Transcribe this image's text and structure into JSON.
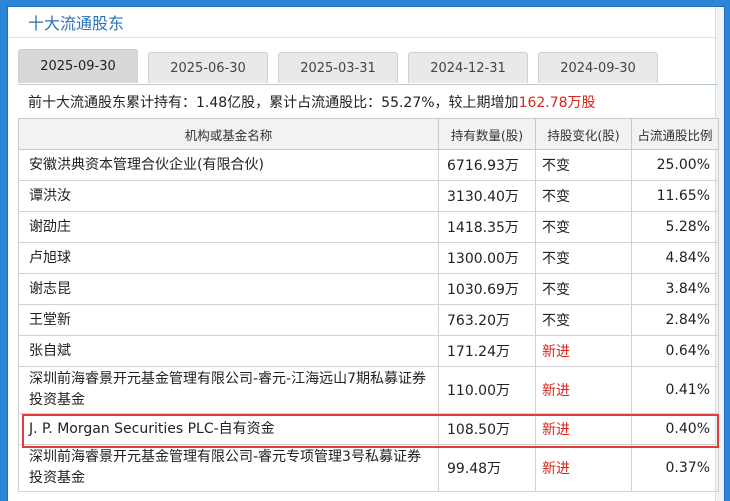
{
  "header": {
    "title": "十大流通股东"
  },
  "tabs": [
    {
      "label": "2025-09-30"
    },
    {
      "label": "2025-06-30"
    },
    {
      "label": "2025-03-31"
    },
    {
      "label": "2024-12-31"
    },
    {
      "label": "2024-09-30"
    }
  ],
  "summary": {
    "prefix": "前十大流通股东累计持有：1.48亿股，累计占流通股比：55.27%，较上期增加",
    "delta": "162.78万股"
  },
  "table": {
    "columns": [
      "机构或基金名称",
      "持有数量(股)",
      "持股变化(股)",
      "占流通股比例"
    ],
    "rows": [
      {
        "name": "安徽洪典资本管理合伙企业(有限合伙)",
        "qty": "6716.93万",
        "change": "不变",
        "pct": "25.00%"
      },
      {
        "name": "谭洪汝",
        "qty": "3130.40万",
        "change": "不变",
        "pct": "11.65%"
      },
      {
        "name": "谢劭庄",
        "qty": "1418.35万",
        "change": "不变",
        "pct": "5.28%"
      },
      {
        "name": "卢旭球",
        "qty": "1300.00万",
        "change": "不变",
        "pct": "4.84%"
      },
      {
        "name": "谢志昆",
        "qty": "1030.69万",
        "change": "不变",
        "pct": "3.84%"
      },
      {
        "name": "王堂新",
        "qty": "763.20万",
        "change": "不变",
        "pct": "2.84%"
      },
      {
        "name": "张自斌",
        "qty": "171.24万",
        "change": "新进",
        "pct": "0.64%"
      },
      {
        "name": "深圳前海睿景开元基金管理有限公司-睿元-江海远山7期私募证券投资基金",
        "qty": "110.00万",
        "change": "新进",
        "pct": "0.41%"
      },
      {
        "name": "J. P. Morgan Securities PLC-自有资金",
        "qty": "108.50万",
        "change": "新进",
        "pct": "0.40%"
      },
      {
        "name": "深圳前海睿景开元基金管理有限公司-睿元专项管理3号私募证券投资基金",
        "qty": "99.48万",
        "change": "新进",
        "pct": "0.37%"
      }
    ]
  },
  "colors": {
    "accent": "#2a73b8",
    "increase": "#d9261c",
    "highlight_border": "#e23b3b"
  }
}
